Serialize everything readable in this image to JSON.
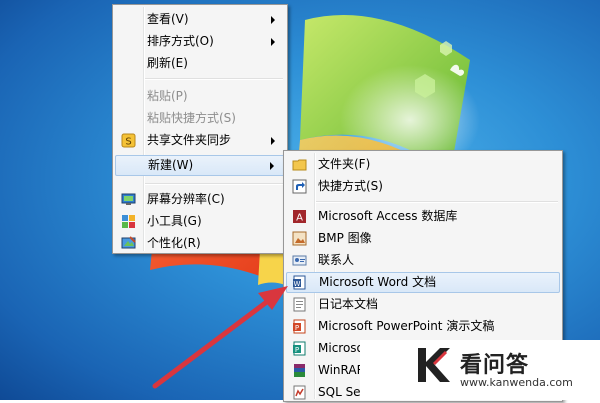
{
  "desktop_menu": {
    "items": [
      {
        "label": "查看(V)",
        "has_submenu": true,
        "enabled": true
      },
      {
        "label": "排序方式(O)",
        "has_submenu": true,
        "enabled": true
      },
      {
        "label": "刷新(E)",
        "enabled": true
      },
      {
        "label": "粘贴(P)",
        "enabled": false
      },
      {
        "label": "粘贴快捷方式(S)",
        "enabled": false
      },
      {
        "label": "共享文件夹同步",
        "has_submenu": true,
        "enabled": true,
        "icon": "sync-icon"
      },
      {
        "label": "新建(W)",
        "has_submenu": true,
        "enabled": true,
        "highlighted": true
      },
      {
        "label": "屏幕分辨率(C)",
        "enabled": true,
        "icon": "monitor-icon"
      },
      {
        "label": "小工具(G)",
        "enabled": true,
        "icon": "gadgets-icon"
      },
      {
        "label": "个性化(R)",
        "enabled": true,
        "icon": "personalize-icon"
      }
    ]
  },
  "new_submenu": {
    "items": [
      {
        "label": "文件夹(F)",
        "icon": "folder-icon"
      },
      {
        "label": "快捷方式(S)",
        "icon": "shortcut-icon"
      },
      {
        "label": "Microsoft Access 数据库",
        "icon": "access-icon"
      },
      {
        "label": "BMP 图像",
        "icon": "bitmap-icon"
      },
      {
        "label": "联系人",
        "icon": "contact-icon"
      },
      {
        "label": "Microsoft Word 文档",
        "icon": "word-icon",
        "highlighted": true
      },
      {
        "label": "日记本文档",
        "icon": "journal-icon"
      },
      {
        "label": "Microsoft PowerPoint 演示文稿",
        "icon": "powerpoint-icon"
      },
      {
        "label": "Microso",
        "icon": "publisher-icon"
      },
      {
        "label": "WinRAR",
        "icon": "winrar-icon"
      },
      {
        "label": "SQL Server Profiler - trace data file",
        "icon": "sql-profiler-icon"
      }
    ]
  },
  "watermark": {
    "title": "看问答",
    "url": "www.kanwenda.com"
  },
  "colors": {
    "menu_bg": "#f5f5f5",
    "highlight_bg": "#dce9f8",
    "highlight_border": "#a8c7e8",
    "arrow_red": "#d9363e",
    "desktop_blue": "#2d8fd6"
  }
}
